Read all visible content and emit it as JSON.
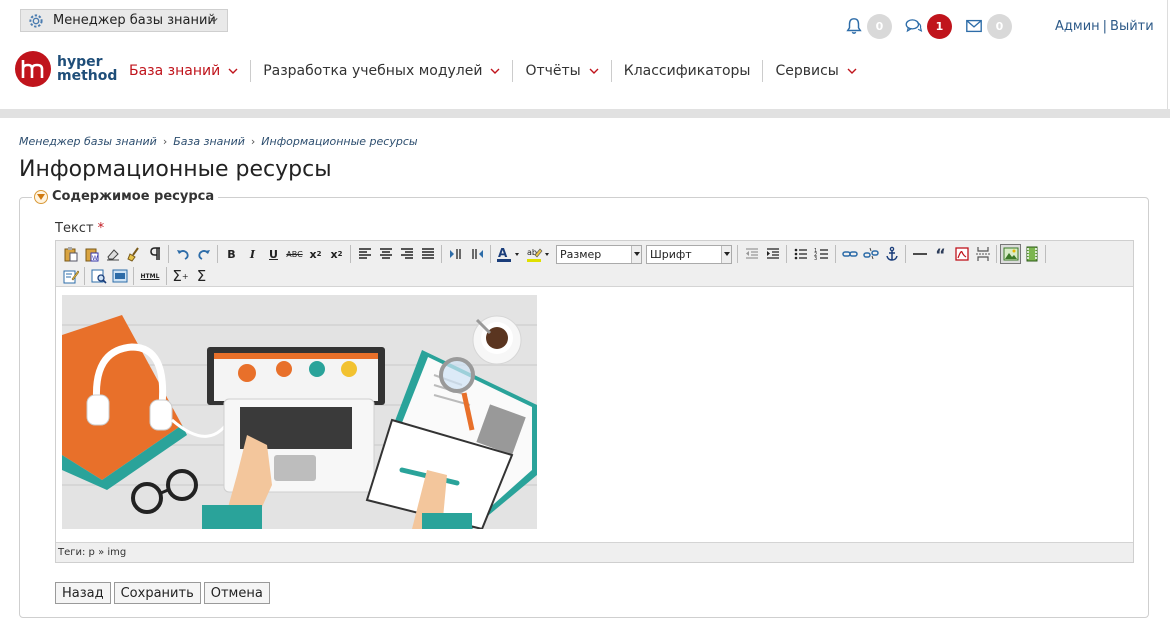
{
  "header": {
    "role_selector": "Менеджер базы знаний",
    "notifications": {
      "bell_count": "0",
      "chat_count": "1",
      "mail_count": "0"
    },
    "user": {
      "name": "Админ",
      "separator": "|",
      "logout": "Выйти"
    },
    "logo": {
      "mark": "hm",
      "line1": "hyper",
      "line2": "method"
    },
    "nav": [
      {
        "label": "База знаний",
        "active": true,
        "dropdown": true
      },
      {
        "label": "Разработка учебных модулей",
        "active": false,
        "dropdown": true
      },
      {
        "label": "Отчёты",
        "active": false,
        "dropdown": true
      },
      {
        "label": "Классификаторы",
        "active": false,
        "dropdown": false
      },
      {
        "label": "Сервисы",
        "active": false,
        "dropdown": true
      }
    ]
  },
  "breadcrumb": [
    "Менеджер базы знаний",
    "База знаний",
    "Информационные ресурсы"
  ],
  "breadcrumb_sep": "›",
  "page_title": "Информационные ресурсы",
  "section": {
    "title": "Содержимое ресурса",
    "field_label": "Текст",
    "required_mark": "*",
    "editor": {
      "size_select": "Размер",
      "font_select": "Шрифт",
      "html_label": "HTML",
      "status": "Теги: p » img",
      "content_image": "illustration-laptop-desk"
    }
  },
  "buttons": {
    "back": "Назад",
    "save": "Сохранить",
    "cancel": "Отмена"
  },
  "colors": {
    "accent": "#c0141c",
    "link": "#2d5a88",
    "logo_text": "#1f4e79"
  }
}
